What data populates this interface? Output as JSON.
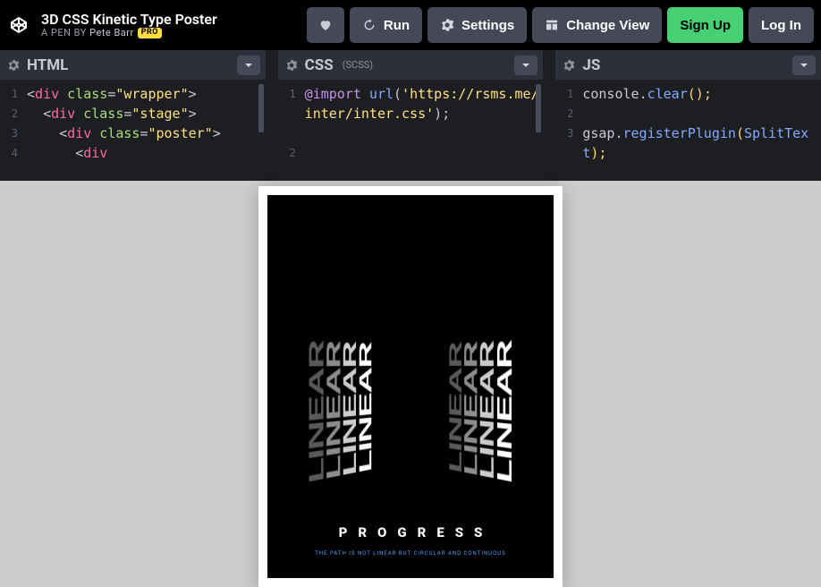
{
  "header": {
    "title": "3D CSS Kinetic Type Poster",
    "byline_prefix": "A PEN BY ",
    "author": "Pete Barr",
    "pro_badge": "PRO",
    "buttons": {
      "run": "Run",
      "settings": "Settings",
      "change_view": "Change View",
      "sign_up": "Sign Up",
      "log_in": "Log In"
    }
  },
  "panes": {
    "html": {
      "label": "HTML",
      "line_numbers": [
        "1",
        "2",
        "3",
        "4"
      ],
      "lines": [
        {
          "type": "html",
          "indent": 0,
          "tag": "div",
          "attr": "class",
          "val": "wrapper"
        },
        {
          "type": "html",
          "indent": 1,
          "tag": "div",
          "attr": "class",
          "val": "stage"
        },
        {
          "type": "html",
          "indent": 2,
          "tag": "div",
          "attr": "class",
          "val": "poster"
        },
        {
          "type": "html-open",
          "indent": 3,
          "tag": "div"
        }
      ]
    },
    "css": {
      "label": "CSS",
      "sub": "(SCSS)",
      "line_numbers": [
        "1",
        "",
        "",
        "2"
      ],
      "code": "@import url('https://rsms.me/inter/inter.css');"
    },
    "js": {
      "label": "JS",
      "line_numbers": [
        "1",
        "2",
        "3"
      ],
      "lines": [
        "console.clear();",
        "",
        "gsap.registerPlugin(SplitText);"
      ]
    }
  },
  "preview": {
    "kinetic_word": "LINEAR",
    "title": "PROGRESS",
    "sub": "THE PATH IS NOT LINEAR BUT CIRCULAR AND CONTINUOUS"
  }
}
